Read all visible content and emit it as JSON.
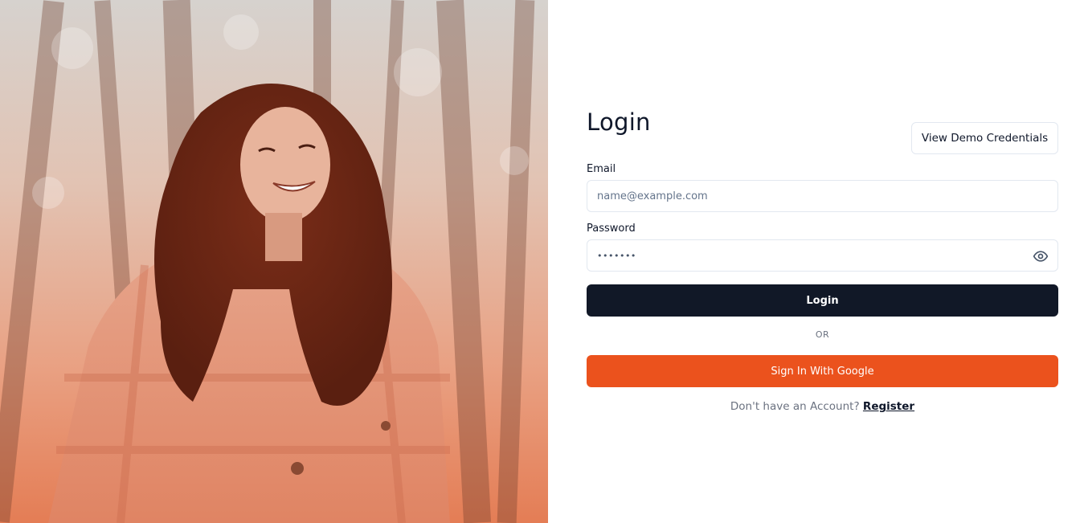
{
  "login": {
    "title": "Login",
    "demo_button_label": "View Demo Credentials",
    "email_label": "Email",
    "email_placeholder": "name@example.com",
    "email_value": "",
    "password_label": "Password",
    "password_value": "•••••••",
    "submit_label": "Login",
    "divider_text": "OR",
    "google_button_label": "Sign In With Google",
    "register_prompt": "Don't have an Account?",
    "register_link_label": "Register"
  },
  "icons": {
    "password_toggle": "eye-icon"
  },
  "colors": {
    "primary_button": "#111827",
    "google_button": "#eb521d",
    "top_accent_line": "#6d5fd8"
  }
}
